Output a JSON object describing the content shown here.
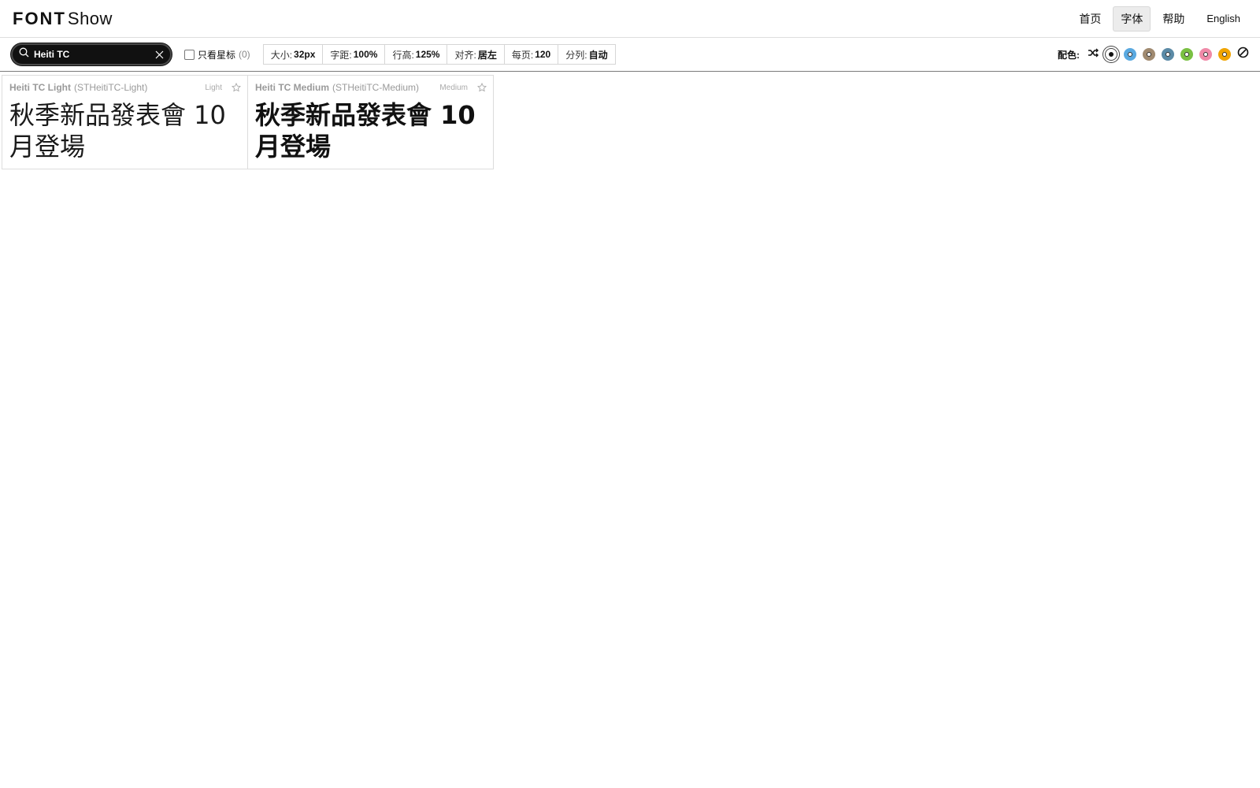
{
  "logo": {
    "bold": "FONT",
    "light": "Show"
  },
  "nav": {
    "home": "首页",
    "fonts": "字体",
    "help": "帮助",
    "lang": "English"
  },
  "toolbar": {
    "search_value": "Heiti TC",
    "starred_label": "只看星标",
    "starred_count": "(0)",
    "settings": [
      {
        "label": "大小:",
        "value": "32px"
      },
      {
        "label": "字距:",
        "value": "100%"
      },
      {
        "label": "行高:",
        "value": "125%"
      },
      {
        "label": "对齐:",
        "value": "居左"
      },
      {
        "label": "每页:",
        "value": "120"
      },
      {
        "label": "分列:",
        "value": "自动"
      }
    ],
    "palette_label": "配色:",
    "palette_colors": [
      "#ffffff",
      "#5aa9e0",
      "#a08a70",
      "#5b8aa6",
      "#7ac043",
      "#f08aa8",
      "#f0a400"
    ]
  },
  "cards": [
    {
      "name": "Heiti TC Light",
      "ps": "(STHeitiTC-Light)",
      "weight": "Light",
      "preview": "秋季新品發表會 10 月登場"
    },
    {
      "name": "Heiti TC Medium",
      "ps": "(STHeitiTC-Medium)",
      "weight": "Medium",
      "preview": "秋季新品發表會 10 月登場"
    }
  ]
}
